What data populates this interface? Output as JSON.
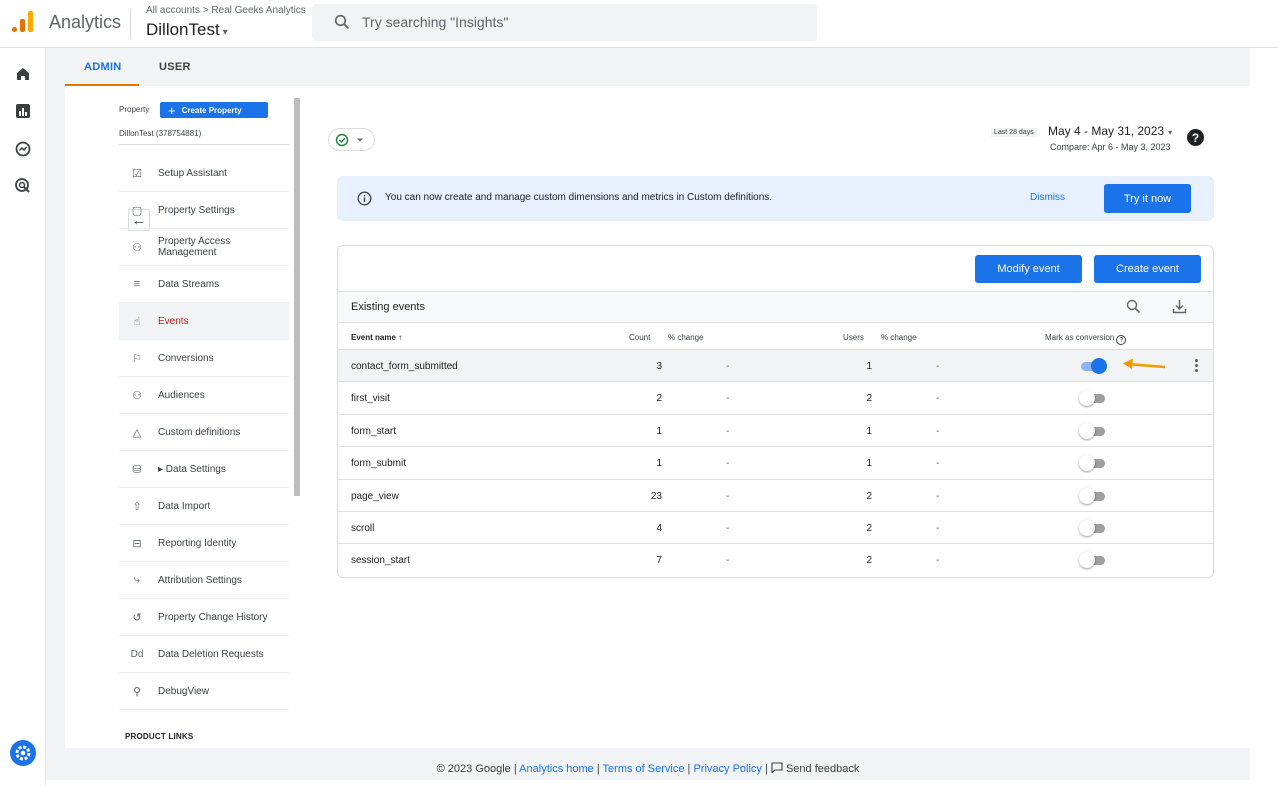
{
  "header": {
    "app_name": "Analytics",
    "breadcrumb": "All accounts > Real Geeks Analytics",
    "account_name": "DillonTest",
    "account_caret": "▾",
    "search_placeholder": "Try searching \"Insights\""
  },
  "tabs": {
    "admin": "ADMIN",
    "user": "USER"
  },
  "property": {
    "label": "Property",
    "create_button": "Create Property",
    "create_plus": "+",
    "id": "DillonTest (378754881)"
  },
  "nav": {
    "back": "←",
    "items": [
      {
        "label": "Setup Assistant",
        "icon": "☑"
      },
      {
        "label": "Property Settings",
        "icon": "▢"
      },
      {
        "label": "Property Access Management",
        "icon": "⚇"
      },
      {
        "label": "Data Streams",
        "icon": "≡"
      },
      {
        "label": "Events",
        "icon": "☝"
      },
      {
        "label": "Conversions",
        "icon": "⚐"
      },
      {
        "label": "Audiences",
        "icon": "⚇"
      },
      {
        "label": "Custom definitions",
        "icon": "△"
      },
      {
        "label": "▸ Data Settings",
        "icon": "⛁"
      },
      {
        "label": "Data Import",
        "icon": "⇧"
      },
      {
        "label": "Reporting Identity",
        "icon": "⊟"
      },
      {
        "label": "Attribution Settings",
        "icon": "⤷"
      },
      {
        "label": "Property Change History",
        "icon": "↺"
      },
      {
        "label": "Data Deletion Requests",
        "icon": "Dd"
      },
      {
        "label": "DebugView",
        "icon": "⚲"
      }
    ],
    "product_links": "PRODUCT LINKS"
  },
  "date": {
    "range_label": "Last 28 days",
    "range": "May 4 - May 31, 2023",
    "caret": "▾",
    "compare": "Compare: Apr 6 - May 3, 2023",
    "help": "?"
  },
  "banner": {
    "message": "You can now create and manage custom dimensions and metrics in Custom definitions.",
    "dismiss": "Dismiss",
    "try_it": "Try it now"
  },
  "events_card": {
    "modify_button": "Modify event",
    "create_button": "Create event",
    "title": "Existing events",
    "columns": {
      "name": "Event name ↑",
      "count": "Count",
      "count_change": "% change",
      "users": "Users",
      "users_change": "% change",
      "mark": "Mark as conversion",
      "mark_help": "?"
    },
    "rows": [
      {
        "name": "contact_form_submitted",
        "count": "3",
        "count_change": "-",
        "users": "1",
        "users_change": "-",
        "conversion": true
      },
      {
        "name": "first_visit",
        "count": "2",
        "count_change": "-",
        "users": "2",
        "users_change": "-",
        "conversion": false
      },
      {
        "name": "form_start",
        "count": "1",
        "count_change": "-",
        "users": "1",
        "users_change": "-",
        "conversion": false
      },
      {
        "name": "form_submit",
        "count": "1",
        "count_change": "-",
        "users": "1",
        "users_change": "-",
        "conversion": false
      },
      {
        "name": "page_view",
        "count": "23",
        "count_change": "-",
        "users": "2",
        "users_change": "-",
        "conversion": false
      },
      {
        "name": "scroll",
        "count": "4",
        "count_change": "-",
        "users": "2",
        "users_change": "-",
        "conversion": false
      },
      {
        "name": "session_start",
        "count": "7",
        "count_change": "-",
        "users": "2",
        "users_change": "-",
        "conversion": false
      }
    ]
  },
  "footer": {
    "copyright": "© 2023 Google |",
    "home": "Analytics home",
    "sep1": "|",
    "terms": "Terms of Service",
    "sep2": "|",
    "privacy": "Privacy Policy",
    "sep3": "|",
    "feedback": "Send feedback"
  },
  "colors": {
    "accent": "#1a73e8",
    "tab_underline": "#e37400",
    "active_nav_text": "#c5221f",
    "annotation_arrow": "#f29900"
  }
}
